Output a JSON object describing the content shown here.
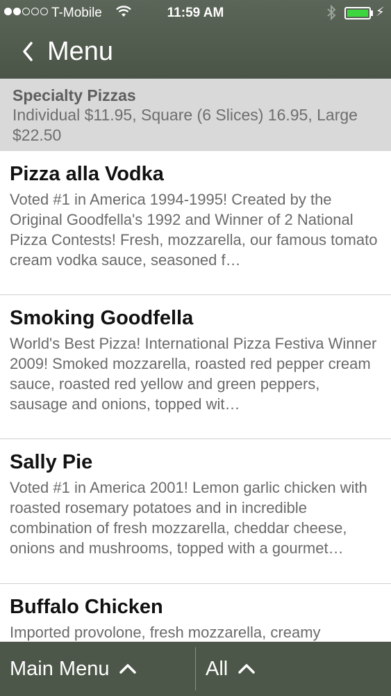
{
  "status": {
    "carrier": "T-Mobile",
    "time": "11:59 AM",
    "signal_bars_filled": 2,
    "signal_bars_total": 5,
    "battery_level": 1.0,
    "wifi_icon": "wifi-icon",
    "bluetooth_icon": "bluetooth-icon"
  },
  "nav": {
    "back_label": "Menu"
  },
  "section": {
    "title": "Specialty Pizzas",
    "subtitle": "Individual $11.95, Square (6 Slices) 16.95, Large $22.50"
  },
  "items": [
    {
      "title": "Pizza alla Vodka",
      "description": "Voted #1 in America 1994-1995! Created by the Original Goodfella's 1992 and Winner of 2 National Pizza Contests! Fresh, mozzarella, our famous tomato cream vodka sauce, seasoned f…"
    },
    {
      "title": "Smoking Goodfella",
      "description": "World's Best Pizza! International Pizza Festiva Winner 2009! Smoked mozzarella, roasted red pepper cream sauce, roasted red yellow and green peppers, sausage and onions, topped wit…"
    },
    {
      "title": "Sally Pie",
      "description": "Voted #1 in America 2001! Lemon garlic chicken with roasted rosemary potatoes and in incredible combination of fresh mozzarella, cheddar cheese, onions and mushrooms, topped with a gourmet…"
    },
    {
      "title": "Buffalo Chicken",
      "description": "Imported provolone, fresh mozzarella, creamy"
    }
  ],
  "bottom": {
    "main_menu_label": "Main Menu",
    "all_label": "All"
  },
  "colors": {
    "bar_green": "#4d5749",
    "section_grey": "#d9d9d9",
    "battery_green": "#3ed63e"
  }
}
